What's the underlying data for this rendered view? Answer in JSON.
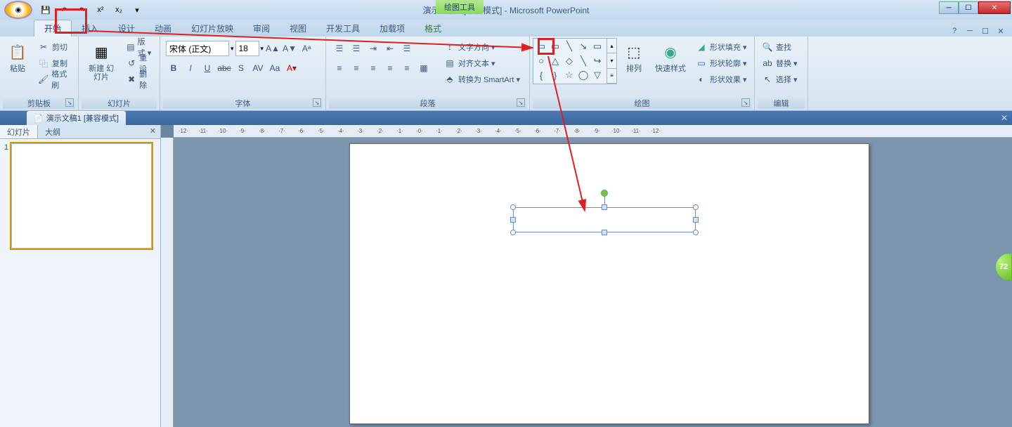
{
  "title": "演示文稿1 [兼容模式] - Microsoft PowerPoint",
  "context_tab": "绘图工具",
  "win": {
    "min": "─",
    "max": "☐",
    "close": "✕"
  },
  "qat": [
    "💾",
    "↶",
    "↷",
    "x²",
    "x₂",
    "▾"
  ],
  "tabs": [
    "开始",
    "插入",
    "设计",
    "动画",
    "幻灯片放映",
    "审阅",
    "视图",
    "开发工具",
    "加载项",
    "格式"
  ],
  "help": [
    "?",
    "─",
    "☐",
    "✕"
  ],
  "ribbon": {
    "clipboard": {
      "label": "剪贴板",
      "paste": "粘贴",
      "cut": "剪切",
      "copy": "复制",
      "painter": "格式刷"
    },
    "slides": {
      "label": "幻灯片",
      "new": "新建\n幻灯片",
      "layout": "版式 ▾",
      "reset": "重设",
      "delete": "删除"
    },
    "font": {
      "label": "字体",
      "name": "宋体 (正文)",
      "size": "18",
      "row1": [
        "A▲",
        "A▼",
        "Aᵃ"
      ],
      "row2": [
        "B",
        "I",
        "U",
        "abc",
        "S",
        "AV",
        "Aa",
        "A▾",
        "A▾"
      ]
    },
    "paragraph": {
      "label": "段落",
      "row1": [
        "☰",
        "☰",
        "☰",
        "☰",
        "⇥",
        "⇤"
      ],
      "row2": [
        "≡",
        "≡",
        "≡",
        "≡",
        "≡",
        "☰",
        "▦"
      ],
      "textdir": "文字方向 ▾",
      "align": "对齐文本 ▾",
      "smartart": "转换为 SmartArt ▾"
    },
    "drawing": {
      "label": "绘图",
      "shapes": [
        "▭",
        "▭",
        "╲",
        "↘",
        "▭",
        "○",
        "△",
        "◇",
        "╲",
        "↪",
        "{",
        "}",
        "☆",
        "◯",
        "▽",
        "⬡"
      ],
      "arrange": "排列",
      "quickstyle": "快速样式",
      "fill": "形状填充 ▾",
      "outline": "形状轮廓 ▾",
      "effects": "形状效果 ▾"
    },
    "editing": {
      "label": "编辑",
      "find": "查找",
      "replace": "替换 ▾",
      "select": "选择 ▾"
    }
  },
  "doc_tab": "演示文稿1 [兼容模式]",
  "side": {
    "tab1": "幻灯片",
    "tab2": "大纲",
    "num": "1"
  },
  "ruler_marks": [
    "12",
    "11",
    "10",
    "9",
    "8",
    "7",
    "6",
    "5",
    "4",
    "3",
    "2",
    "1",
    "0",
    "1",
    "2",
    "3",
    "4",
    "5",
    "6",
    "7",
    "8",
    "9",
    "10",
    "11",
    "12"
  ],
  "bubble": "72"
}
